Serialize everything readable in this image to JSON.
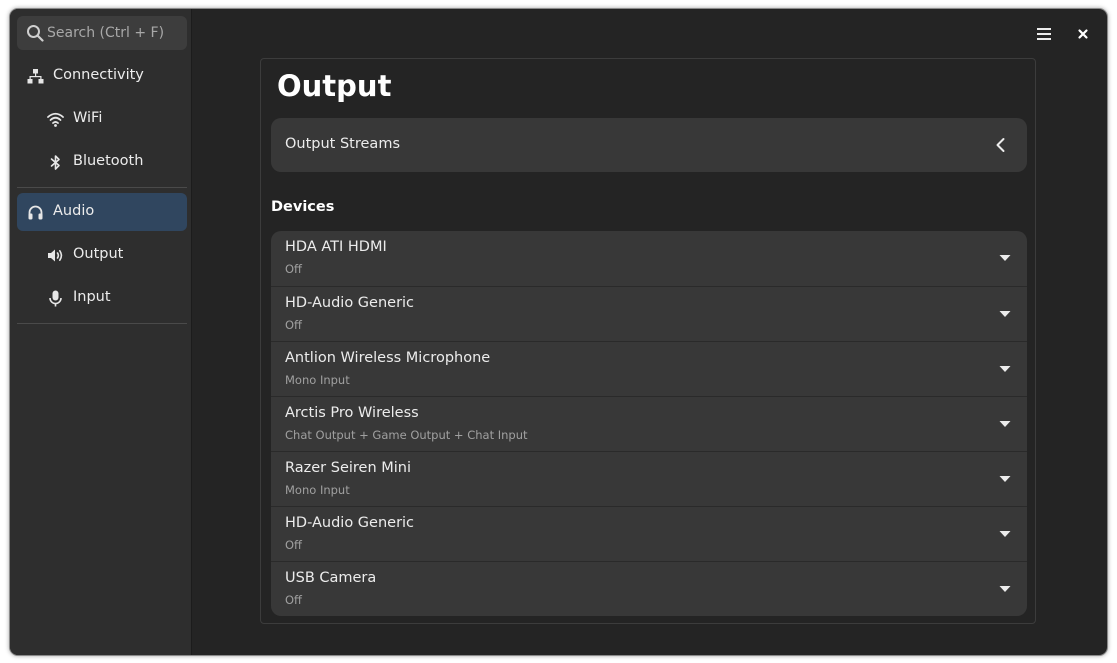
{
  "search": {
    "placeholder": "Search (Ctrl + F)",
    "icon": "search-icon"
  },
  "sidebar": {
    "items": [
      {
        "label": "Connectivity",
        "icon": "network-icon",
        "active": false,
        "indent": false
      },
      {
        "label": "WiFi",
        "icon": "wifi-icon",
        "active": false,
        "indent": true
      },
      {
        "label": "Bluetooth",
        "icon": "bluetooth-icon",
        "active": false,
        "indent": true
      },
      {
        "label": "Audio",
        "icon": "headphones-icon",
        "active": true,
        "indent": false
      },
      {
        "label": "Output",
        "icon": "speaker-icon",
        "active": false,
        "indent": true
      },
      {
        "label": "Input",
        "icon": "microphone-icon",
        "active": false,
        "indent": true
      }
    ]
  },
  "header": {
    "menu_icon": "hamburger-menu-icon",
    "close_icon": "close-icon"
  },
  "main": {
    "title": "Output",
    "streams_label": "Output Streams",
    "devices_heading": "Devices",
    "devices": [
      {
        "name": "HDA ATI HDMI",
        "status": "Off"
      },
      {
        "name": "HD-Audio Generic",
        "status": "Off"
      },
      {
        "name": "Antlion Wireless Microphone",
        "status": "Mono Input"
      },
      {
        "name": "Arctis Pro Wireless",
        "status": "Chat Output + Game Output + Chat Input"
      },
      {
        "name": "Razer Seiren Mini",
        "status": "Mono Input"
      },
      {
        "name": "HD-Audio Generic",
        "status": "Off"
      },
      {
        "name": "USB Camera",
        "status": "Off"
      }
    ]
  },
  "colors": {
    "window_bg": "#242424",
    "sidebar_bg": "#2e2e2e",
    "active_item_bg": "#30465f",
    "card_bg": "#383838",
    "text_primary": "#ececec",
    "text_secondary": "#a0a0a0"
  }
}
